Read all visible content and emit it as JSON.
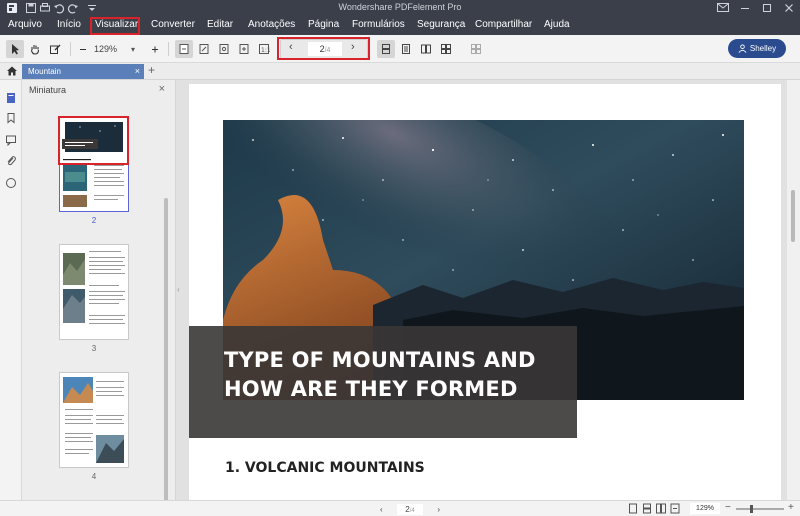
{
  "app": {
    "title": "Wondershare PDFelement Pro"
  },
  "menu": {
    "items": [
      "Arquivo",
      "Início",
      "Visualizar",
      "Converter",
      "Editar",
      "Anotações",
      "Página",
      "Formulários",
      "Segurança",
      "Compartilhar",
      "Ajuda"
    ],
    "active": "Visualizar"
  },
  "toolbar": {
    "zoom_value": "129%",
    "page_current": "2",
    "page_total": "/4",
    "user_name": "Shelley"
  },
  "tabs": {
    "document_tab": "Mountain",
    "add_tab": "+"
  },
  "thumbnails": {
    "panel_title": "Miniatura",
    "close_label": "×",
    "pages": [
      "2",
      "3",
      "4"
    ],
    "selected_page": "2"
  },
  "document": {
    "headline": "TYPE OF MOUNTAINS AND HOW ARE THEY FORMED",
    "section_heading": "1. VOLCANIC MOUNTAINS"
  },
  "status": {
    "page_current": "2",
    "page_total": "/4",
    "zoom_value": "129%"
  },
  "colors": {
    "titlebar": "#3b3f4a",
    "user_button": "#2b4b8f",
    "doc_tab": "#5b7fb8",
    "highlight": "#d9232a",
    "thumb_selected": "#5a66d6"
  }
}
